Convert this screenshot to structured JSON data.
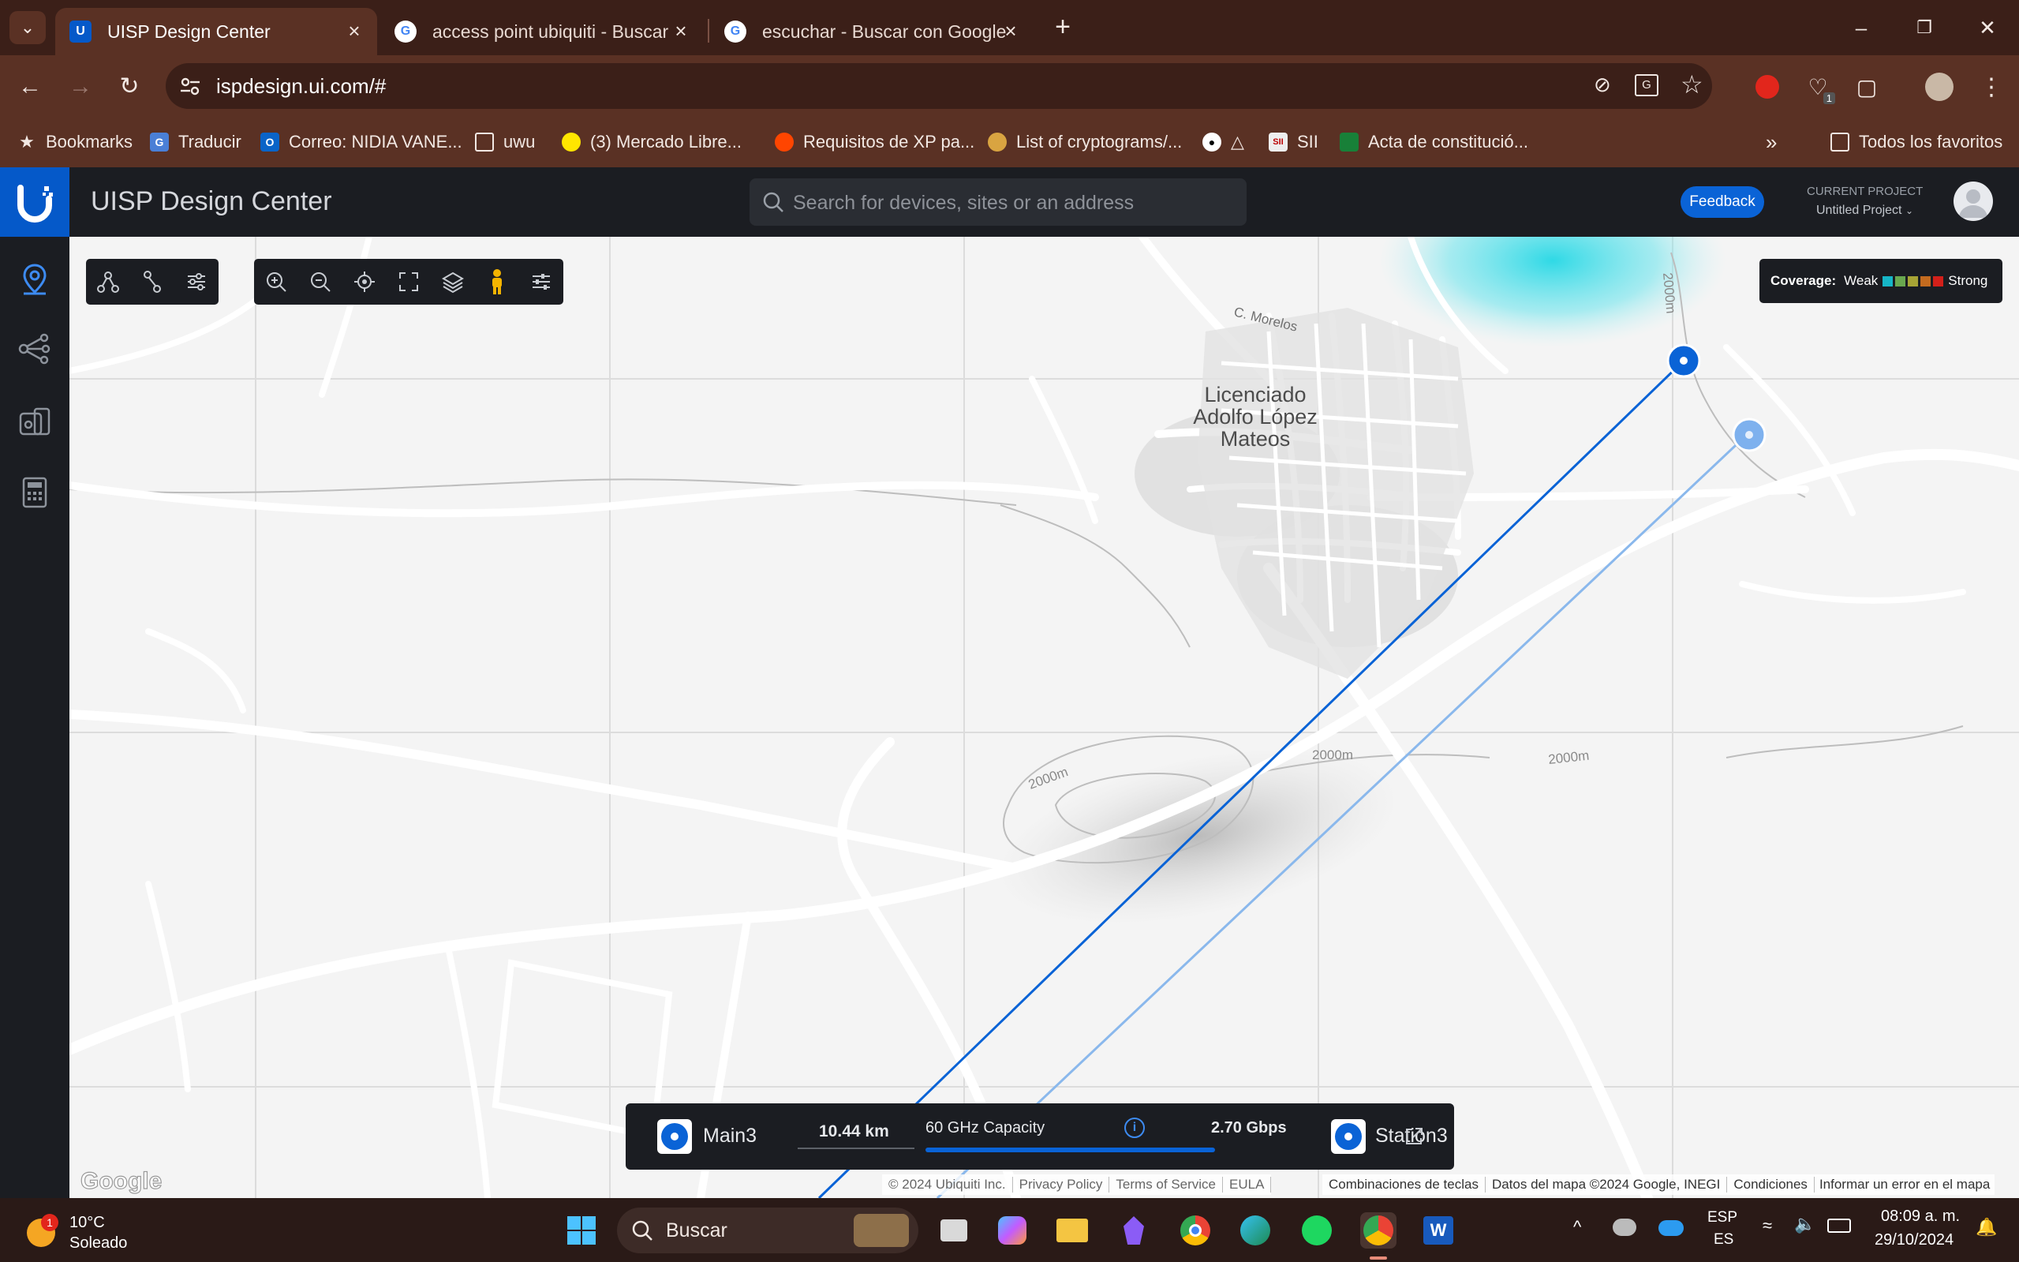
{
  "browser": {
    "tabs": [
      {
        "title": "UISP Design Center",
        "active": true
      },
      {
        "title": "access point ubiquiti - Buscar co"
      },
      {
        "title": "escuchar - Buscar con Google"
      }
    ],
    "url": "ispdesign.ui.com/#",
    "bookmarks": [
      {
        "label": "Bookmarks",
        "icon": "star-icon"
      },
      {
        "label": "Traducir",
        "icon": "translate-icon"
      },
      {
        "label": "Correo: NIDIA VANE...",
        "icon": "outlook-icon"
      },
      {
        "label": "uwu",
        "icon": "folder-icon"
      },
      {
        "label": "(3) Mercado Libre...",
        "icon": "mercadolibre-icon"
      },
      {
        "label": "Requisitos de XP pa...",
        "icon": "reddit-icon"
      },
      {
        "label": "List of cryptograms/...",
        "icon": "hand-icon"
      },
      {
        "label": "△",
        "icon": "eye-icon"
      },
      {
        "label": "SII",
        "icon": "sii-icon"
      },
      {
        "label": "Acta de constitució...",
        "icon": "sheets-icon"
      }
    ],
    "all_bookmarks": "Todos los favoritos",
    "extension_badge": "1"
  },
  "app": {
    "title": "UISP Design Center",
    "search_placeholder": "Search for devices, sites or an address",
    "feedback": "Feedback",
    "current_project_label": "CURRENT PROJECT",
    "current_project": "Untitled Project"
  },
  "map": {
    "town_label": [
      "Licenciado",
      "Adolfo López",
      "Mateos"
    ],
    "street_label": "C. Morelos",
    "contours": [
      "2000m",
      "2000m",
      "2000m",
      "2000m"
    ],
    "coverage": {
      "label": "Coverage:",
      "weak": "Weak",
      "strong": "Strong",
      "colors": [
        "#16b6c7",
        "#6aa84f",
        "#a7a435",
        "#c46b1f",
        "#d3201a"
      ]
    },
    "link_colors": {
      "primary": "#0a63d6",
      "secondary": "#8ab8ec"
    },
    "google": "Google",
    "footer_left": [
      "© 2024 Ubiquiti Inc.",
      "Privacy Policy",
      "Terms of Service",
      "EULA"
    ],
    "footer_right": [
      "Combinaciones de teclas",
      "Datos del mapa ©2024 Google, INEGI",
      "Condiciones",
      "Informar un error en el mapa"
    ]
  },
  "link": {
    "device_a": "Main3",
    "distance": "10.44 km",
    "capacity_label": "60 GHz Capacity",
    "capacity": "2.70 Gbps",
    "device_b": "Station3"
  },
  "taskbar": {
    "weather_temp": "10°C",
    "weather_desc": "Soleado",
    "weather_badge": "1",
    "search": "Buscar",
    "lang_top": "ESP",
    "lang_bottom": "ES",
    "time": "08:09 a. m.",
    "date": "29/10/2024"
  }
}
